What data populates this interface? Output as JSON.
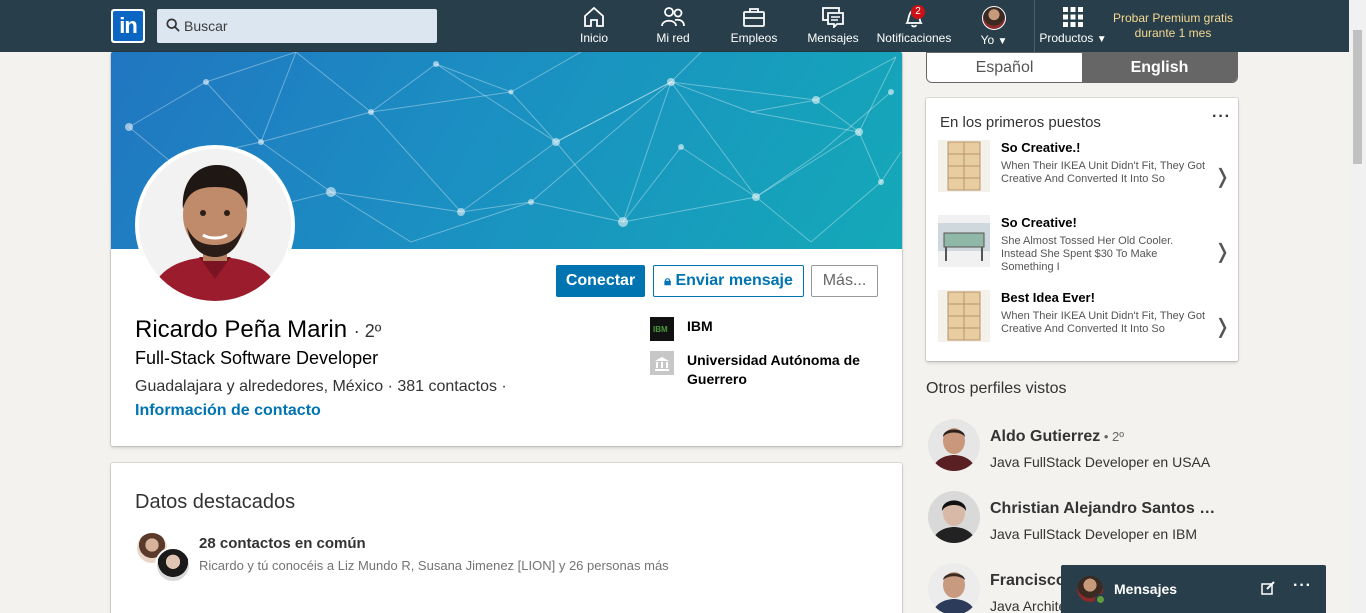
{
  "nav": {
    "logo": "in",
    "search_placeholder": "Buscar",
    "items": [
      {
        "label": "Inicio",
        "icon": "home-icon"
      },
      {
        "label": "Mi red",
        "icon": "network-icon"
      },
      {
        "label": "Empleos",
        "icon": "briefcase-icon"
      },
      {
        "label": "Mensajes",
        "icon": "messages-icon"
      },
      {
        "label": "Notificaciones",
        "icon": "bell-icon",
        "badge": "2"
      },
      {
        "label": "Yo",
        "icon": "avatar-icon"
      },
      {
        "label": "Productos",
        "icon": "grid-icon"
      }
    ],
    "premium": "Probar Premium gratis durante 1 mes"
  },
  "profile": {
    "name": "Ricardo Peña Marin",
    "degree": "· 2º",
    "headline": "Full-Stack Software Developer",
    "location": "Guadalajara y alrededores, México  ·  381 contactos  ·",
    "contact_link": "Información de contacto",
    "connect_label": "Conectar",
    "message_label": "Enviar mensaje",
    "more_label": "Más...",
    "orgs": [
      {
        "name": "IBM",
        "logo": "ibm-logo"
      },
      {
        "name": "Universidad Autónoma de Guerrero",
        "logo": "university-icon"
      }
    ]
  },
  "highlights": {
    "title": "Datos destacados",
    "main": "28 contactos en común",
    "sub": "Ricardo y tú conocéis a Liz Mundo R, Susana Jimenez [LION] y 26 personas más"
  },
  "language": {
    "es": "Español",
    "en": "English",
    "active": "English"
  },
  "ads": {
    "title": "En los primeros puestos",
    "menu": "···",
    "items": [
      {
        "head": "So Creative.!",
        "text": "When Their IKEA Unit Didn't Fit, They Got Creative And Converted It Into So",
        "thumb": "shelf-thumbnail"
      },
      {
        "head": "So Creative!",
        "text": "She Almost Tossed Her Old Cooler. Instead She Spent $30 To Make Something I",
        "thumb": "cooler-thumbnail"
      },
      {
        "head": "Best Idea Ever!",
        "text": "When Their IKEA Unit Didn't Fit, They Got Creative And Converted It Into So",
        "thumb": "shelf-thumbnail"
      }
    ],
    "chevron": "❭"
  },
  "others": {
    "title": "Otros perfiles vistos",
    "people": [
      {
        "name": "Aldo Gutierrez",
        "degree": " • 2º",
        "title": "Java FullStack Developer en USAA"
      },
      {
        "name": "Christian Alejandro Santos Ga...",
        "degree": "",
        "title": "Java FullStack Developer en IBM"
      },
      {
        "name": "Francisco",
        "degree": "",
        "title": "Java Archite"
      }
    ]
  },
  "messaging": {
    "label": "Mensajes",
    "menu": "···"
  },
  "colors": {
    "nav_bg": "#283e4a",
    "brand_blue": "#0073b1",
    "premium_gold": "#f5d992",
    "badge_red": "#cc1016"
  }
}
